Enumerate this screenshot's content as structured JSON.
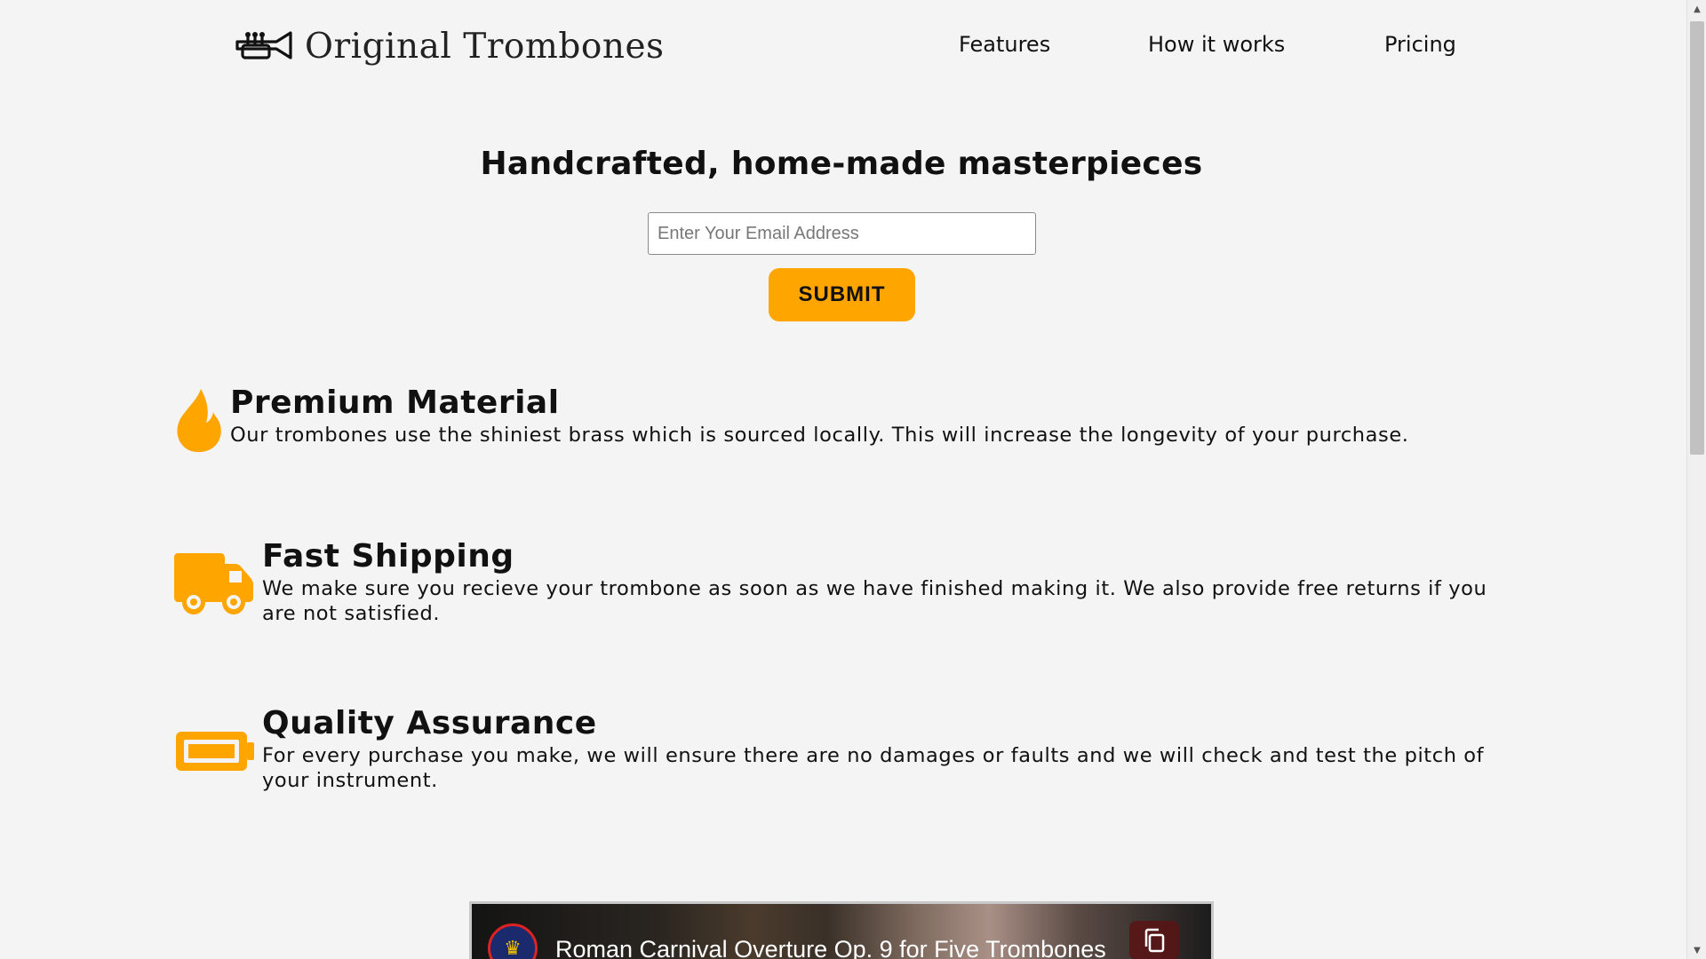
{
  "header": {
    "logo_text": "Original Trombones",
    "nav": [
      {
        "label": "Features"
      },
      {
        "label": "How it works"
      },
      {
        "label": "Pricing"
      }
    ]
  },
  "hero": {
    "title": "Handcrafted, home-made masterpieces",
    "email_placeholder": "Enter Your Email Address",
    "submit_label": "SUBMIT"
  },
  "features": [
    {
      "icon": "fire-icon",
      "title": "Premium Material",
      "description": "Our trombones use the shiniest brass which is sourced locally. This will increase the longevity of your purchase."
    },
    {
      "icon": "truck-icon",
      "title": "Fast Shipping",
      "description": "We make sure you recieve your trombone as soon as we have finished making it. We also provide free returns if you are not satisfied."
    },
    {
      "icon": "battery-icon",
      "title": "Quality Assurance",
      "description": "For every purchase you make, we will ensure there are no damages or faults and we will check and test the pitch of your instrument."
    }
  ],
  "video": {
    "title": "Roman Carnival Overture Op. 9 for Five Trombones",
    "channel_icon": "channel-avatar-icon",
    "copy_icon": "copy-link-icon"
  },
  "colors": {
    "accent": "#ffa500",
    "background": "#f4f4f4",
    "text": "#111111"
  }
}
